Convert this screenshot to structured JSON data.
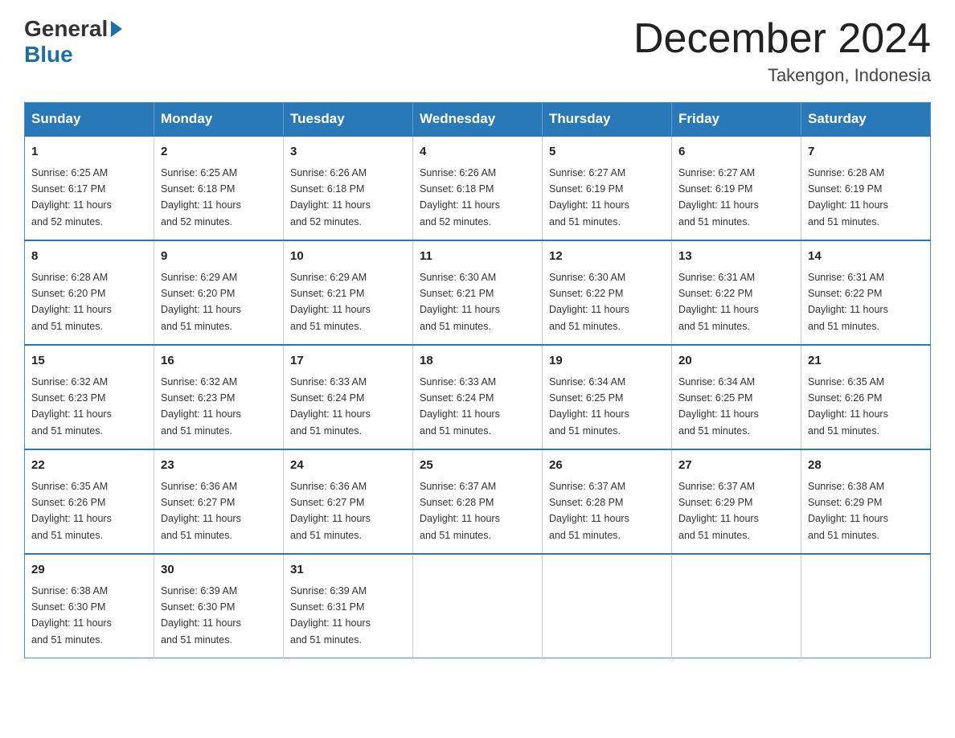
{
  "logo": {
    "general": "General",
    "blue": "Blue"
  },
  "title": "December 2024",
  "location": "Takengon, Indonesia",
  "days_of_week": [
    "Sunday",
    "Monday",
    "Tuesday",
    "Wednesday",
    "Thursday",
    "Friday",
    "Saturday"
  ],
  "weeks": [
    [
      {
        "day": "1",
        "sunrise": "6:25 AM",
        "sunset": "6:17 PM",
        "daylight": "11 hours and 52 minutes."
      },
      {
        "day": "2",
        "sunrise": "6:25 AM",
        "sunset": "6:18 PM",
        "daylight": "11 hours and 52 minutes."
      },
      {
        "day": "3",
        "sunrise": "6:26 AM",
        "sunset": "6:18 PM",
        "daylight": "11 hours and 52 minutes."
      },
      {
        "day": "4",
        "sunrise": "6:26 AM",
        "sunset": "6:18 PM",
        "daylight": "11 hours and 52 minutes."
      },
      {
        "day": "5",
        "sunrise": "6:27 AM",
        "sunset": "6:19 PM",
        "daylight": "11 hours and 51 minutes."
      },
      {
        "day": "6",
        "sunrise": "6:27 AM",
        "sunset": "6:19 PM",
        "daylight": "11 hours and 51 minutes."
      },
      {
        "day": "7",
        "sunrise": "6:28 AM",
        "sunset": "6:19 PM",
        "daylight": "11 hours and 51 minutes."
      }
    ],
    [
      {
        "day": "8",
        "sunrise": "6:28 AM",
        "sunset": "6:20 PM",
        "daylight": "11 hours and 51 minutes."
      },
      {
        "day": "9",
        "sunrise": "6:29 AM",
        "sunset": "6:20 PM",
        "daylight": "11 hours and 51 minutes."
      },
      {
        "day": "10",
        "sunrise": "6:29 AM",
        "sunset": "6:21 PM",
        "daylight": "11 hours and 51 minutes."
      },
      {
        "day": "11",
        "sunrise": "6:30 AM",
        "sunset": "6:21 PM",
        "daylight": "11 hours and 51 minutes."
      },
      {
        "day": "12",
        "sunrise": "6:30 AM",
        "sunset": "6:22 PM",
        "daylight": "11 hours and 51 minutes."
      },
      {
        "day": "13",
        "sunrise": "6:31 AM",
        "sunset": "6:22 PM",
        "daylight": "11 hours and 51 minutes."
      },
      {
        "day": "14",
        "sunrise": "6:31 AM",
        "sunset": "6:22 PM",
        "daylight": "11 hours and 51 minutes."
      }
    ],
    [
      {
        "day": "15",
        "sunrise": "6:32 AM",
        "sunset": "6:23 PM",
        "daylight": "11 hours and 51 minutes."
      },
      {
        "day": "16",
        "sunrise": "6:32 AM",
        "sunset": "6:23 PM",
        "daylight": "11 hours and 51 minutes."
      },
      {
        "day": "17",
        "sunrise": "6:33 AM",
        "sunset": "6:24 PM",
        "daylight": "11 hours and 51 minutes."
      },
      {
        "day": "18",
        "sunrise": "6:33 AM",
        "sunset": "6:24 PM",
        "daylight": "11 hours and 51 minutes."
      },
      {
        "day": "19",
        "sunrise": "6:34 AM",
        "sunset": "6:25 PM",
        "daylight": "11 hours and 51 minutes."
      },
      {
        "day": "20",
        "sunrise": "6:34 AM",
        "sunset": "6:25 PM",
        "daylight": "11 hours and 51 minutes."
      },
      {
        "day": "21",
        "sunrise": "6:35 AM",
        "sunset": "6:26 PM",
        "daylight": "11 hours and 51 minutes."
      }
    ],
    [
      {
        "day": "22",
        "sunrise": "6:35 AM",
        "sunset": "6:26 PM",
        "daylight": "11 hours and 51 minutes."
      },
      {
        "day": "23",
        "sunrise": "6:36 AM",
        "sunset": "6:27 PM",
        "daylight": "11 hours and 51 minutes."
      },
      {
        "day": "24",
        "sunrise": "6:36 AM",
        "sunset": "6:27 PM",
        "daylight": "11 hours and 51 minutes."
      },
      {
        "day": "25",
        "sunrise": "6:37 AM",
        "sunset": "6:28 PM",
        "daylight": "11 hours and 51 minutes."
      },
      {
        "day": "26",
        "sunrise": "6:37 AM",
        "sunset": "6:28 PM",
        "daylight": "11 hours and 51 minutes."
      },
      {
        "day": "27",
        "sunrise": "6:37 AM",
        "sunset": "6:29 PM",
        "daylight": "11 hours and 51 minutes."
      },
      {
        "day": "28",
        "sunrise": "6:38 AM",
        "sunset": "6:29 PM",
        "daylight": "11 hours and 51 minutes."
      }
    ],
    [
      {
        "day": "29",
        "sunrise": "6:38 AM",
        "sunset": "6:30 PM",
        "daylight": "11 hours and 51 minutes."
      },
      {
        "day": "30",
        "sunrise": "6:39 AM",
        "sunset": "6:30 PM",
        "daylight": "11 hours and 51 minutes."
      },
      {
        "day": "31",
        "sunrise": "6:39 AM",
        "sunset": "6:31 PM",
        "daylight": "11 hours and 51 minutes."
      },
      null,
      null,
      null,
      null
    ]
  ],
  "labels": {
    "sunrise": "Sunrise:",
    "sunset": "Sunset:",
    "daylight": "Daylight:"
  }
}
